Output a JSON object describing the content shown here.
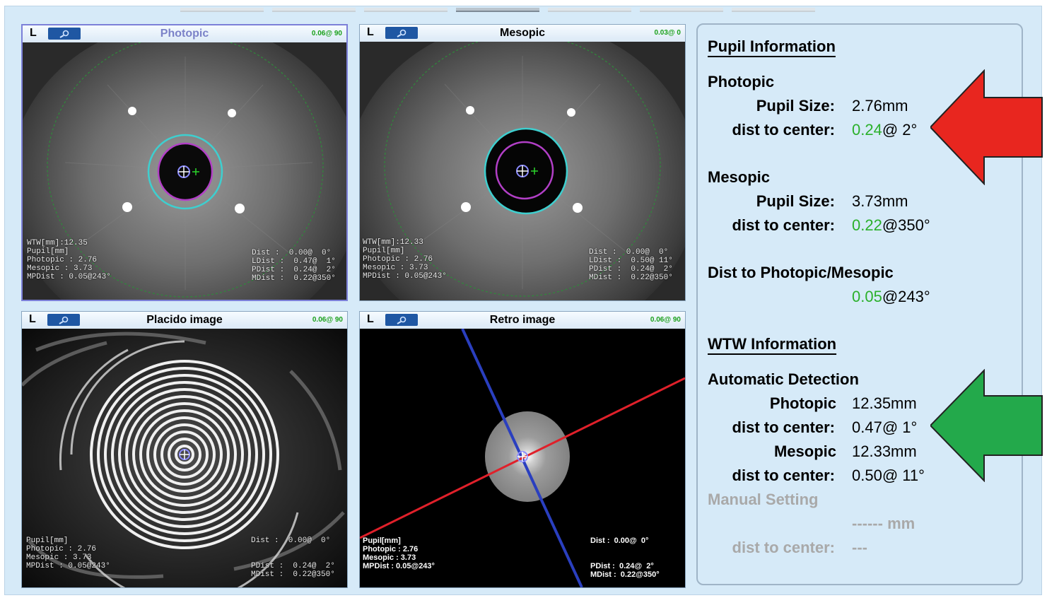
{
  "tabs": [
    "",
    "",
    "",
    "",
    "",
    "",
    ""
  ],
  "panels": {
    "photopic": {
      "eye": "L",
      "title": "Photopic",
      "status": "0.06@ 90",
      "left_text": "WTW[mm]:12.35\nPupil[mm]\nPhotopic : 2.76\nMesopic : 3.73\nMPDist : 0.05@243°",
      "right_text": "Dist :  0.00@  0°\nLDist :  0.47@  1°\nPDist :  0.24@  2°\nMDist :  0.22@350°"
    },
    "mesopic": {
      "eye": "L",
      "title": "Mesopic",
      "status": "0.03@ 0",
      "left_text": "WTW[mm]:12.33\nPupil[mm]\nPhotopic : 2.76\nMesopic : 3.73\nMPDist : 0.05@243°",
      "right_text": "Dist :  0.00@  0°\nLDist :  0.50@ 11°\nPDist :  0.24@  2°\nMDist :  0.22@350°"
    },
    "placido": {
      "eye": "L",
      "title": "Placido image",
      "status": "0.06@ 90",
      "left_text": "Pupil[mm]\nPhotopic : 2.76\nMesopic : 3.73\nMPDist : 0.05@243°",
      "right_top": "Dist :  0.00@  0°",
      "right_text": "PDist :  0.24@  2°\nMDist :  0.22@350°"
    },
    "retro": {
      "eye": "L",
      "title": "Retro image",
      "status": "0.06@ 90",
      "left_text": "Pupil[mm]\nPhotopic : 2.76\nMesopic : 3.73\nMPDist : 0.05@243°",
      "right_top": "Dist :  0.00@  0°",
      "right_text": "PDist :  0.24@  2°\nMDist :  0.22@350°"
    }
  },
  "info": {
    "pupil_header": "Pupil Information",
    "photopic_header": "Photopic",
    "photopic_size_label": "Pupil Size:",
    "photopic_size_value": "2.76mm",
    "photopic_dist_label": "dist to center:",
    "photopic_dist_green": "0.24",
    "photopic_dist_rest": "@  2°",
    "mesopic_header": "Mesopic",
    "mesopic_size_label": "Pupil Size:",
    "mesopic_size_value": "3.73mm",
    "mesopic_dist_label": "dist to center:",
    "mesopic_dist_green": "0.22",
    "mesopic_dist_rest": "@350°",
    "pm_header": "Dist to Photopic/Mesopic",
    "pm_green": "0.05",
    "pm_rest": "@243°",
    "wtw_header": "WTW Information",
    "auto_header": "Automatic Detection",
    "auto_photopic_label": "Photopic",
    "auto_photopic_value": "12.35mm",
    "auto_photopic_dist_label": "dist to center:",
    "auto_photopic_dist_value": "0.47@  1°",
    "auto_mesopic_label": "Mesopic",
    "auto_mesopic_value": "12.33mm",
    "auto_mesopic_dist_label": "dist to center:",
    "auto_mesopic_dist_value": "0.50@ 11°",
    "manual_header": "Manual Setting",
    "manual_value": "------ mm",
    "manual_dist_label": "dist to center:",
    "manual_dist_value": "---"
  },
  "colors": {
    "arrow_red": "#e8261f",
    "arrow_green": "#23a94b",
    "accent_green": "#2bb02b",
    "panel_blue": "#1f57a3"
  }
}
